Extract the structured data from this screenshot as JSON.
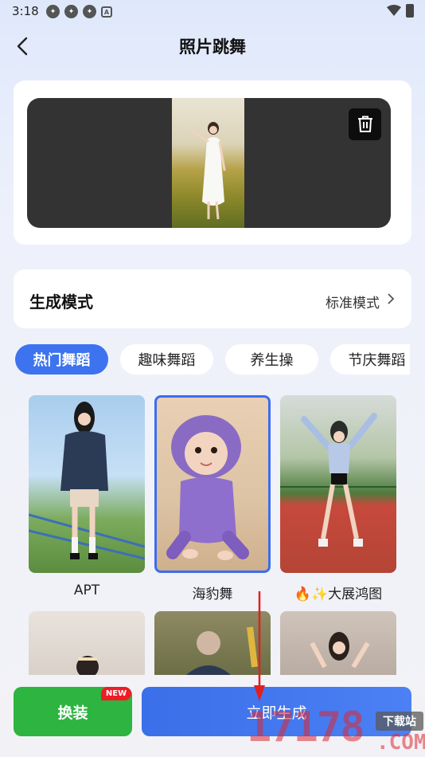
{
  "status_bar": {
    "time": "3:18"
  },
  "header": {
    "title": "照片跳舞"
  },
  "mode": {
    "label": "生成模式",
    "value": "标准模式"
  },
  "tabs": [
    {
      "label": "热门舞蹈",
      "active": true
    },
    {
      "label": "趣味舞蹈",
      "active": false
    },
    {
      "label": "养生操",
      "active": false
    },
    {
      "label": "节庆舞蹈",
      "active": false
    }
  ],
  "templates": [
    {
      "label": "APT",
      "selected": false
    },
    {
      "label": "海豹舞",
      "selected": true
    },
    {
      "label": "大展鸿图",
      "icons": [
        "fire-icon",
        "sparkle-icon"
      ],
      "selected": false
    }
  ],
  "buttons": {
    "dress_up": "换装",
    "new_badge": "NEW",
    "generate": "立即生成"
  },
  "watermark": {
    "site": "下载站",
    "number": "17178",
    "domain": ".COM"
  },
  "colors": {
    "accent": "#3d73ef",
    "green": "#2db441",
    "badge_red": "#ee1c25"
  }
}
